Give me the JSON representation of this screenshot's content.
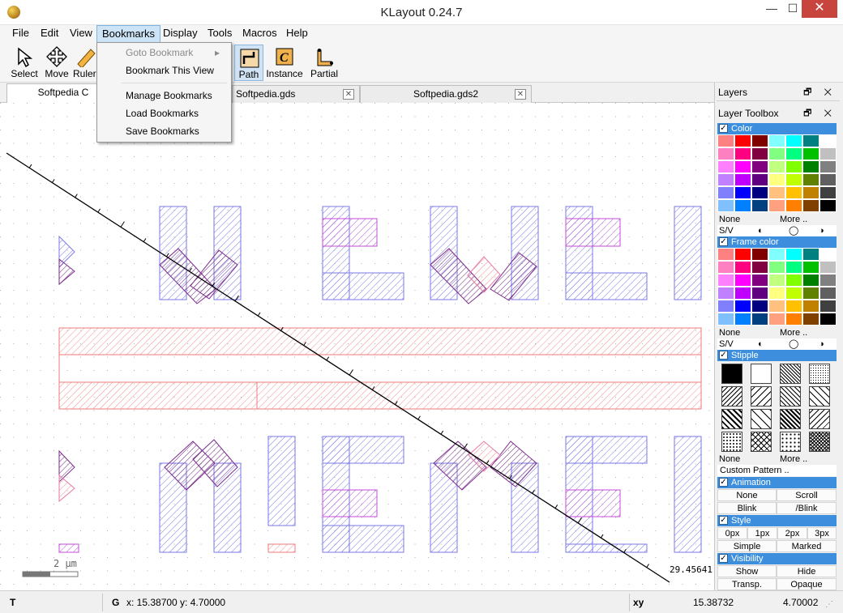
{
  "window": {
    "title": "KLayout 0.24.7",
    "minimize": "—",
    "maximize": "☐",
    "close": "✕"
  },
  "menubar": [
    {
      "label": "File"
    },
    {
      "label": "Edit"
    },
    {
      "label": "View"
    },
    {
      "label": "Bookmarks"
    },
    {
      "label": "Display"
    },
    {
      "label": "Tools"
    },
    {
      "label": "Macros"
    },
    {
      "label": "Help"
    }
  ],
  "toolbar": {
    "select": "Select",
    "move": "Move",
    "ruler": "Ruler",
    "path": "Path",
    "instance": "Instance",
    "partial": "Partial"
  },
  "bookmarks_menu": {
    "goto": "Goto Bookmark",
    "goto_arrow": "▸",
    "this_view": "Bookmark This View",
    "manage": "Manage Bookmarks",
    "load": "Load Bookmarks",
    "save": "Save Bookmarks"
  },
  "tabs": [
    "Softpedia C",
    "Softpedia.gds",
    "Softpedia.gds2"
  ],
  "tab_close": "✕",
  "canvas": {
    "scale_label": "2 µm",
    "ruler_value": "29.45641"
  },
  "panel": {
    "layers": "Layers",
    "layer_toolbox": "Layer Toolbox",
    "dock_ctrl": "🗗 ✕",
    "color": "Color",
    "frame_color": "Frame color",
    "stipple": "Stipple",
    "animation": "Animation",
    "style": "Style",
    "visibility": "Visibility",
    "none": "None",
    "more": "More ..",
    "sv": "S/V",
    "custom_pattern": "Custom Pattern ..",
    "anim_none": "None",
    "anim_scroll": "Scroll",
    "anim_blink": "Blink",
    "anim_iblink": "/Blink",
    "w0": "0px",
    "w1": "1px",
    "w2": "2px",
    "w3": "3px",
    "simple": "Simple",
    "marked": "Marked",
    "show": "Show",
    "hide": "Hide",
    "transp": "Transp.",
    "opaque": "Opaque",
    "check": "✓"
  },
  "palette": [
    "#ff8080",
    "#ff0000",
    "#800000",
    "#80ffff",
    "#00ffff",
    "#008080",
    "#ffffff",
    "#ff80c0",
    "#ff0080",
    "#800040",
    "#80ff80",
    "#00ff80",
    "#00c000",
    "#c0c0c0",
    "#ff80ff",
    "#ff00ff",
    "#800080",
    "#c0ff80",
    "#80ff00",
    "#008000",
    "#808080",
    "#c080ff",
    "#c000ff",
    "#600080",
    "#ffff80",
    "#c0ff00",
    "#608000",
    "#606060",
    "#8080ff",
    "#0000ff",
    "#000080",
    "#ffc080",
    "#ffc000",
    "#c08000",
    "#404040",
    "#80c0ff",
    "#0080ff",
    "#004080",
    "#ffa080",
    "#ff8000",
    "#804000",
    "#000000"
  ],
  "status": {
    "mode": "T",
    "grid": "G",
    "coords": "x: 15.38700  y: 4.70000",
    "xy": "xy",
    "x": "15.38732",
    "y": "4.70002"
  }
}
